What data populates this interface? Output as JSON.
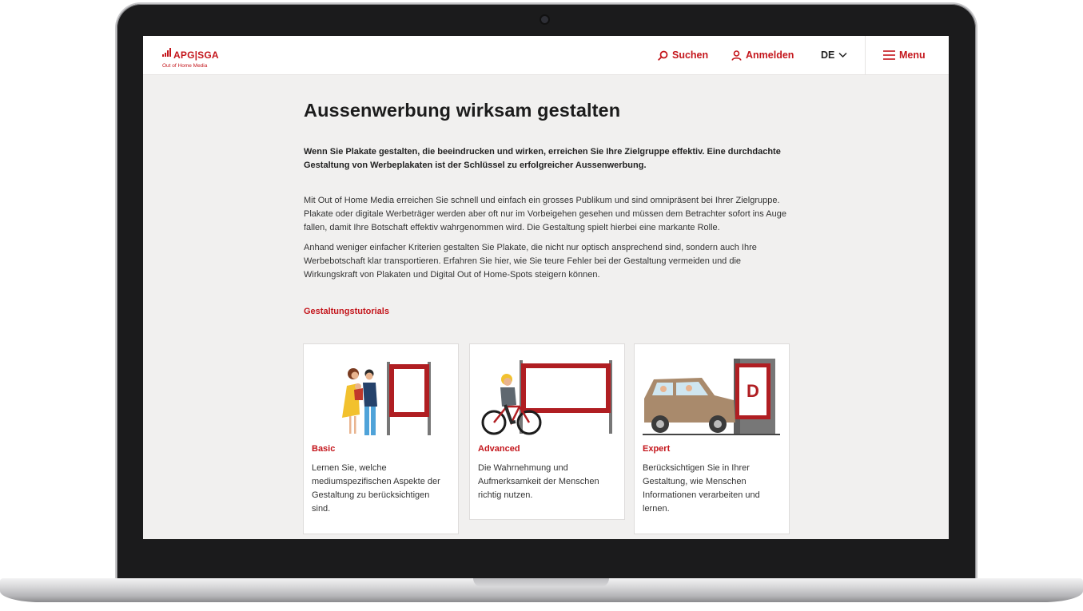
{
  "header": {
    "logo_text": "APG|SGA",
    "logo_sub": "Out of Home Media",
    "search_label": "Suchen",
    "login_label": "Anmelden",
    "lang_label": "DE",
    "menu_label": "Menu",
    "icons": [
      "search-icon",
      "user-icon",
      "chevron-down-icon",
      "hamburger-icon"
    ]
  },
  "main": {
    "title": "Aussenwerbung wirksam gestalten",
    "lead": "Wenn Sie Plakate gestalten, die beeindrucken und wirken, erreichen Sie Ihre Zielgruppe effektiv. Eine durchdachte Gestaltung von Werbeplakaten ist der Schlüssel zu erfolgreicher Aussenwerbung.",
    "paragraph1": "Mit Out of Home Media erreichen Sie schnell und einfach ein grosses Publikum und sind omnipräsent bei Ihrer Zielgruppe. Plakate oder digitale Werbeträger werden aber oft nur im Vorbeigehen gesehen und müssen dem Betrachter sofort ins Auge fallen, damit Ihre Botschaft effektiv wahrgenommen wird. Die Gestaltung spielt hierbei eine markante Rolle.",
    "paragraph2": "Anhand weniger einfacher Kriterien gestalten Sie Plakate, die nicht nur optisch ansprechend sind, sondern auch Ihre Werbebotschaft klar transportieren. Erfahren Sie hier, wie Sie teure Fehler bei der Gestaltung vermeiden und die Wirkungskraft von Plakaten und Digital Out of Home-Spots steigern können.",
    "section_label": "Gestaltungstutorials"
  },
  "cards": [
    {
      "title": "Basic",
      "text": "Lernen Sie, welche mediumspezifischen Aspekte der Gestaltung zu berücksichtigen sind."
    },
    {
      "title": "Advanced",
      "text": "Die Wahrnehmung und Aufmerksamkeit der Menschen richtig nutzen."
    },
    {
      "title": "Expert",
      "text": "Berücksichtigen Sie in Ihrer Gestaltung, wie Menschen Informationen verarbeiten und lernen.",
      "billboard_letter": "D"
    }
  ],
  "colors": {
    "accent": "#c4161c",
    "page_bg": "#f1f0ef",
    "text": "#1c1c1c"
  }
}
